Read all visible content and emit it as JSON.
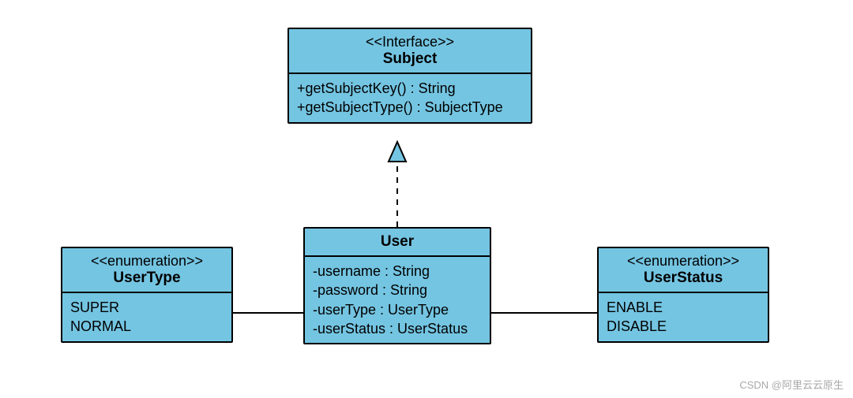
{
  "subject": {
    "stereotype": "<<Interface>>",
    "name": "Subject",
    "methods": [
      "+getSubjectKey() : String",
      "+getSubjectType() : SubjectType"
    ]
  },
  "user": {
    "name": "User",
    "attributes": [
      "-username : String",
      "-password : String",
      "-userType : UserType",
      "-userStatus : UserStatus"
    ]
  },
  "usertype": {
    "stereotype": "<<enumeration>>",
    "name": "UserType",
    "literals": [
      "SUPER",
      "NORMAL"
    ]
  },
  "userstatus": {
    "stereotype": "<<enumeration>>",
    "name": "UserStatus",
    "literals": [
      "ENABLE",
      "DISABLE"
    ]
  },
  "watermark": "CSDN @阿里云云原生"
}
